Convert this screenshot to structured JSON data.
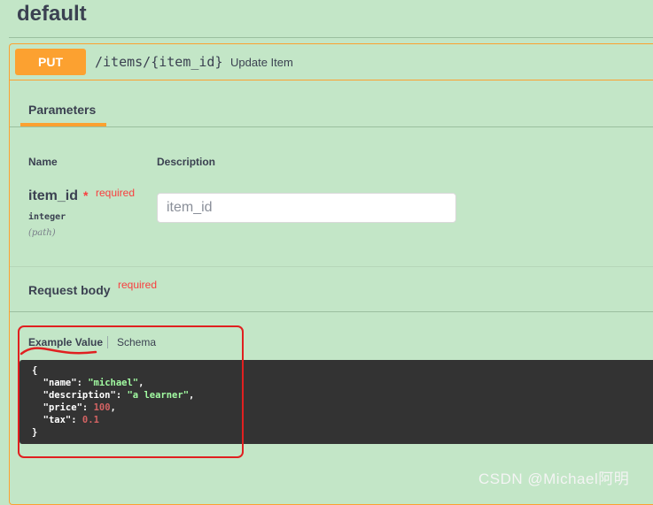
{
  "section": {
    "title": "default"
  },
  "operation": {
    "method": "PUT",
    "path": "/items/{item_id}",
    "summary": "Update Item"
  },
  "tabs": {
    "parameters": "Parameters"
  },
  "params_table": {
    "col_name": "Name",
    "col_description": "Description",
    "rows": [
      {
        "name": "item_id",
        "required_star": "*",
        "required_label": "required",
        "type": "integer",
        "location": "(path)",
        "placeholder": "item_id"
      }
    ]
  },
  "request_body": {
    "title": "Request body",
    "required_label": "required",
    "tab_example": "Example Value",
    "tab_schema": "Schema",
    "code": {
      "open": "{",
      "name_key": "  \"name\"",
      "name_val": "\"michael\"",
      "desc_key": "  \"description\"",
      "desc_val": "\"a learner\"",
      "price_key": "  \"price\"",
      "price_val": "100",
      "tax_key": "  \"tax\"",
      "tax_val": "0.1",
      "close": "}"
    }
  },
  "watermark": "CSDN @Michael阿明",
  "colors": {
    "accent_put": "#fca130",
    "background": "#c3e6c7",
    "required": "#f93e3e",
    "annotation": "#e02020"
  }
}
